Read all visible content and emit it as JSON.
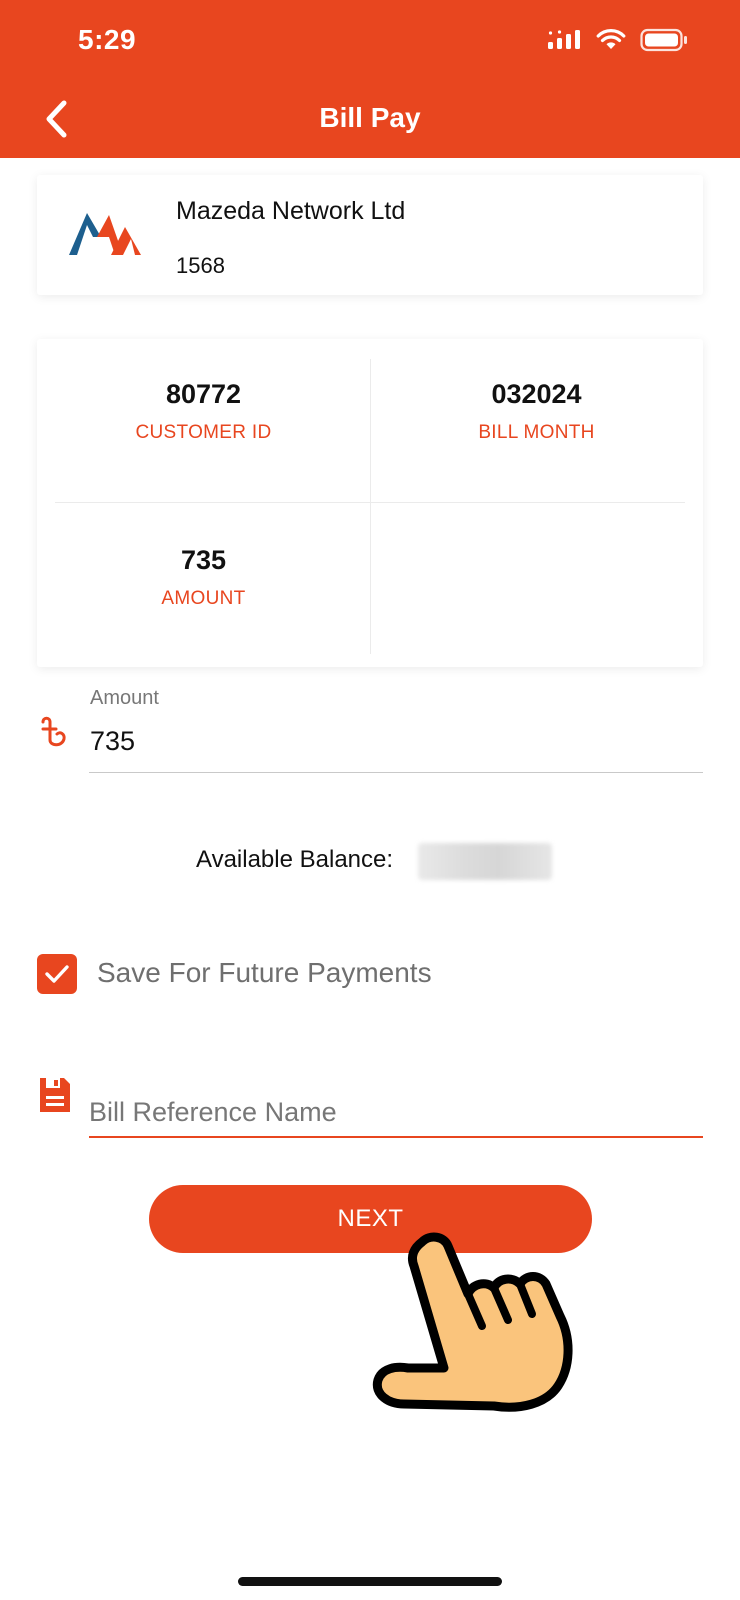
{
  "status_bar": {
    "time": "5:29",
    "icons": [
      "signal-icon",
      "wifi-icon",
      "battery-icon"
    ]
  },
  "header": {
    "title": "Bill Pay",
    "back_icon": "chevron-left-icon"
  },
  "biller": {
    "name": "Mazeda Network Ltd",
    "code": "1568",
    "logo": "mazeda-logo"
  },
  "bill_info": {
    "customer_id": {
      "value": "80772",
      "label": "CUSTOMER ID"
    },
    "bill_month": {
      "value": "032024",
      "label": "BILL MONTH"
    },
    "amount": {
      "value": "735",
      "label": "AMOUNT"
    }
  },
  "amount_field": {
    "label": "Amount",
    "value": "735",
    "icon": "taka-icon"
  },
  "balance": {
    "label": "Available Balance:"
  },
  "save_option": {
    "label": "Save For Future Payments",
    "checked": true
  },
  "reference_field": {
    "placeholder": "Bill Reference Name",
    "icon": "save-icon"
  },
  "next_button": {
    "label": "NEXT"
  },
  "colors": {
    "accent": "#E8461F",
    "text": "#111111",
    "muted": "#777777"
  }
}
